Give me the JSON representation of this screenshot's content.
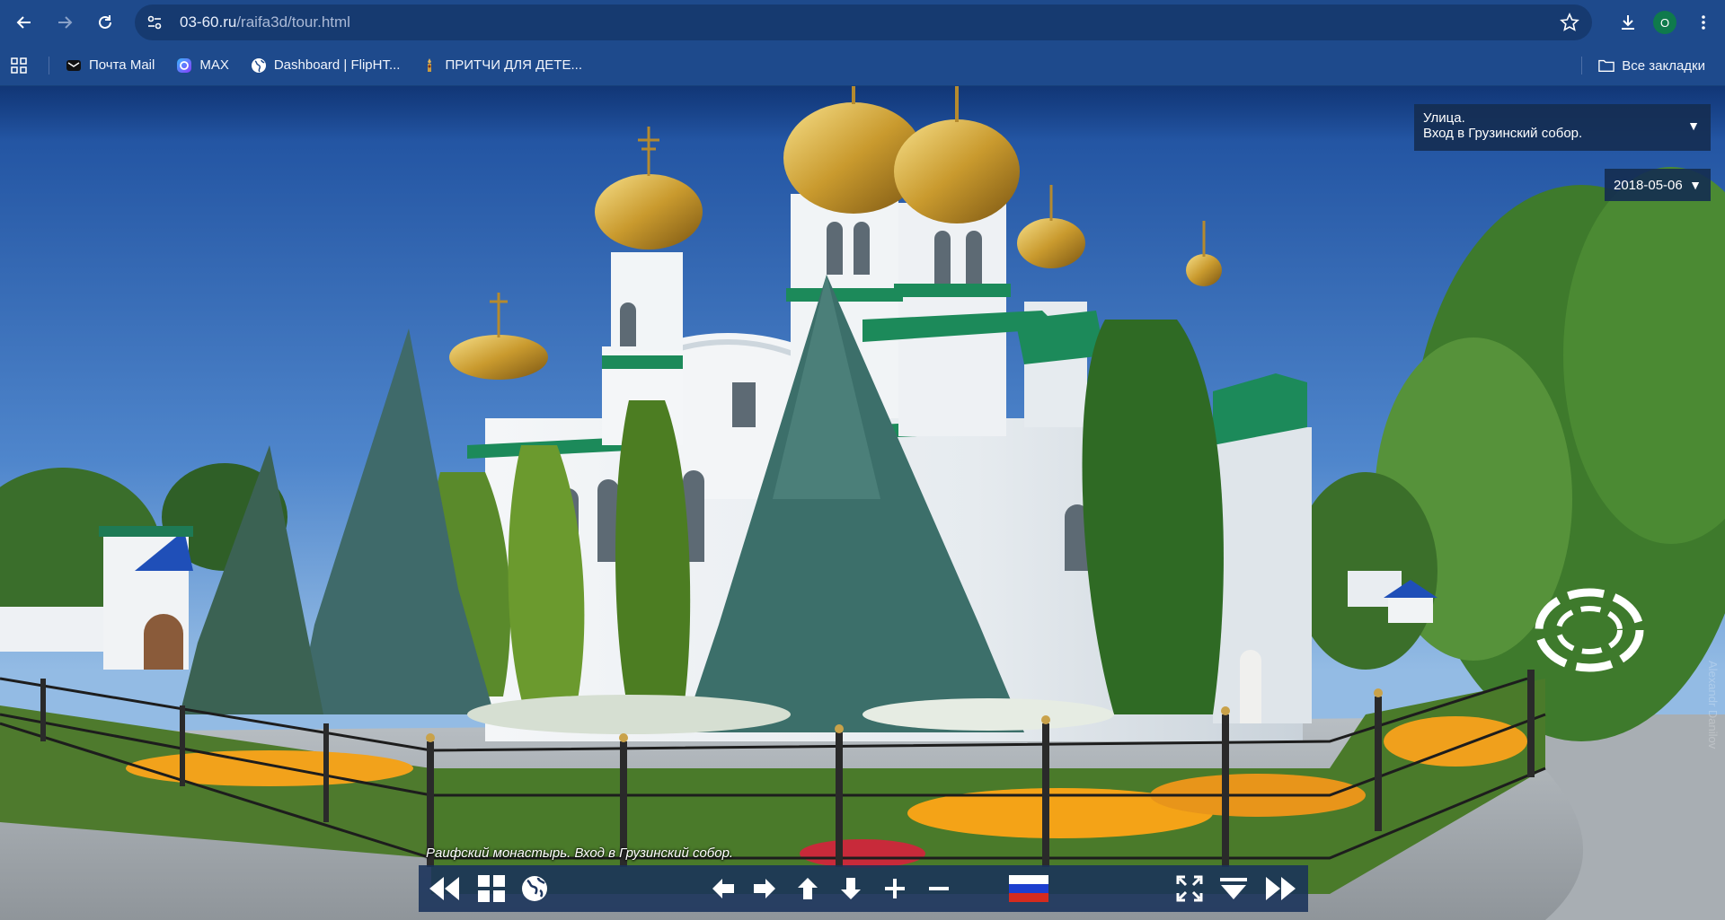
{
  "browser": {
    "url_host": "03-60.ru",
    "url_path": "/raifa3d/tour.html",
    "profile_initial": "О",
    "bookmarks": [
      {
        "label": "Почта Mail",
        "icon": "mail-icon"
      },
      {
        "label": "MAX",
        "icon": "max-app-icon"
      },
      {
        "label": "Dashboard | FlipHT...",
        "icon": "globe-icon"
      },
      {
        "label": "ПРИТЧИ ДЛЯ ДЕТЕ...",
        "icon": "bookmark-favicon-icon"
      }
    ],
    "all_bookmarks_label": "Все закладки"
  },
  "tour": {
    "location_line1": "Улица.",
    "location_line2": "Вход в Грузинский собор.",
    "date": "2018-05-06",
    "caption": "Раифский монастырь. Вход в Грузинский собор.",
    "watermark": "Alexandr Danilov"
  },
  "controls": [
    "prev-scene-icon",
    "thumbnails-grid-icon",
    "map-globe-icon",
    "pan-left-icon",
    "pan-right-icon",
    "pan-up-icon",
    "pan-down-icon",
    "zoom-in-icon",
    "zoom-out-icon",
    "language-flag-icon",
    "fullscreen-icon",
    "hide-bar-icon",
    "next-scene-icon"
  ],
  "colors": {
    "chrome_blue": "#1e4a8c",
    "sky_top": "#2d5fb0",
    "sky_bottom": "#88b3e2",
    "panel": "#142c50"
  }
}
